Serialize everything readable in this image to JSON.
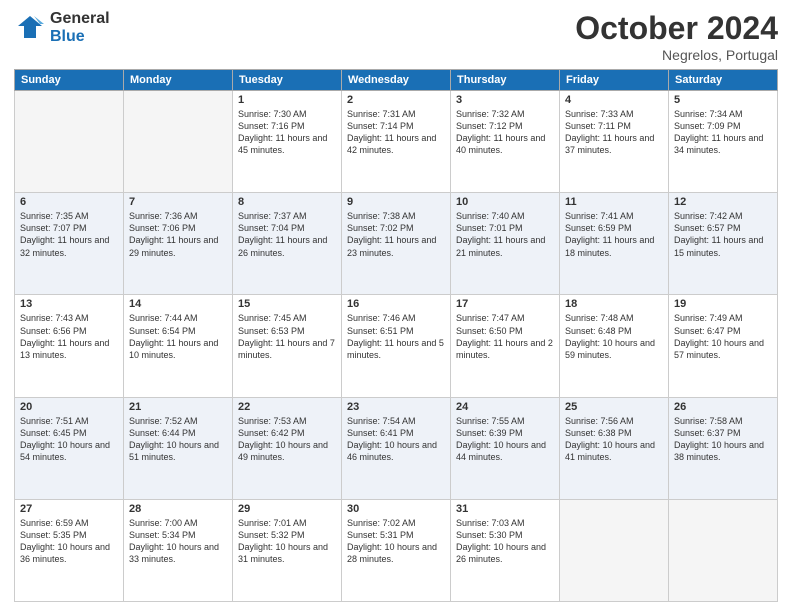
{
  "header": {
    "logo_general": "General",
    "logo_blue": "Blue",
    "month_title": "October 2024",
    "location": "Negrelos, Portugal"
  },
  "days_of_week": [
    "Sunday",
    "Monday",
    "Tuesday",
    "Wednesday",
    "Thursday",
    "Friday",
    "Saturday"
  ],
  "weeks": [
    [
      {
        "day": "",
        "info": ""
      },
      {
        "day": "",
        "info": ""
      },
      {
        "day": "1",
        "info": "Sunrise: 7:30 AM\nSunset: 7:16 PM\nDaylight: 11 hours and 45 minutes."
      },
      {
        "day": "2",
        "info": "Sunrise: 7:31 AM\nSunset: 7:14 PM\nDaylight: 11 hours and 42 minutes."
      },
      {
        "day": "3",
        "info": "Sunrise: 7:32 AM\nSunset: 7:12 PM\nDaylight: 11 hours and 40 minutes."
      },
      {
        "day": "4",
        "info": "Sunrise: 7:33 AM\nSunset: 7:11 PM\nDaylight: 11 hours and 37 minutes."
      },
      {
        "day": "5",
        "info": "Sunrise: 7:34 AM\nSunset: 7:09 PM\nDaylight: 11 hours and 34 minutes."
      }
    ],
    [
      {
        "day": "6",
        "info": "Sunrise: 7:35 AM\nSunset: 7:07 PM\nDaylight: 11 hours and 32 minutes."
      },
      {
        "day": "7",
        "info": "Sunrise: 7:36 AM\nSunset: 7:06 PM\nDaylight: 11 hours and 29 minutes."
      },
      {
        "day": "8",
        "info": "Sunrise: 7:37 AM\nSunset: 7:04 PM\nDaylight: 11 hours and 26 minutes."
      },
      {
        "day": "9",
        "info": "Sunrise: 7:38 AM\nSunset: 7:02 PM\nDaylight: 11 hours and 23 minutes."
      },
      {
        "day": "10",
        "info": "Sunrise: 7:40 AM\nSunset: 7:01 PM\nDaylight: 11 hours and 21 minutes."
      },
      {
        "day": "11",
        "info": "Sunrise: 7:41 AM\nSunset: 6:59 PM\nDaylight: 11 hours and 18 minutes."
      },
      {
        "day": "12",
        "info": "Sunrise: 7:42 AM\nSunset: 6:57 PM\nDaylight: 11 hours and 15 minutes."
      }
    ],
    [
      {
        "day": "13",
        "info": "Sunrise: 7:43 AM\nSunset: 6:56 PM\nDaylight: 11 hours and 13 minutes."
      },
      {
        "day": "14",
        "info": "Sunrise: 7:44 AM\nSunset: 6:54 PM\nDaylight: 11 hours and 10 minutes."
      },
      {
        "day": "15",
        "info": "Sunrise: 7:45 AM\nSunset: 6:53 PM\nDaylight: 11 hours and 7 minutes."
      },
      {
        "day": "16",
        "info": "Sunrise: 7:46 AM\nSunset: 6:51 PM\nDaylight: 11 hours and 5 minutes."
      },
      {
        "day": "17",
        "info": "Sunrise: 7:47 AM\nSunset: 6:50 PM\nDaylight: 11 hours and 2 minutes."
      },
      {
        "day": "18",
        "info": "Sunrise: 7:48 AM\nSunset: 6:48 PM\nDaylight: 10 hours and 59 minutes."
      },
      {
        "day": "19",
        "info": "Sunrise: 7:49 AM\nSunset: 6:47 PM\nDaylight: 10 hours and 57 minutes."
      }
    ],
    [
      {
        "day": "20",
        "info": "Sunrise: 7:51 AM\nSunset: 6:45 PM\nDaylight: 10 hours and 54 minutes."
      },
      {
        "day": "21",
        "info": "Sunrise: 7:52 AM\nSunset: 6:44 PM\nDaylight: 10 hours and 51 minutes."
      },
      {
        "day": "22",
        "info": "Sunrise: 7:53 AM\nSunset: 6:42 PM\nDaylight: 10 hours and 49 minutes."
      },
      {
        "day": "23",
        "info": "Sunrise: 7:54 AM\nSunset: 6:41 PM\nDaylight: 10 hours and 46 minutes."
      },
      {
        "day": "24",
        "info": "Sunrise: 7:55 AM\nSunset: 6:39 PM\nDaylight: 10 hours and 44 minutes."
      },
      {
        "day": "25",
        "info": "Sunrise: 7:56 AM\nSunset: 6:38 PM\nDaylight: 10 hours and 41 minutes."
      },
      {
        "day": "26",
        "info": "Sunrise: 7:58 AM\nSunset: 6:37 PM\nDaylight: 10 hours and 38 minutes."
      }
    ],
    [
      {
        "day": "27",
        "info": "Sunrise: 6:59 AM\nSunset: 5:35 PM\nDaylight: 10 hours and 36 minutes."
      },
      {
        "day": "28",
        "info": "Sunrise: 7:00 AM\nSunset: 5:34 PM\nDaylight: 10 hours and 33 minutes."
      },
      {
        "day": "29",
        "info": "Sunrise: 7:01 AM\nSunset: 5:32 PM\nDaylight: 10 hours and 31 minutes."
      },
      {
        "day": "30",
        "info": "Sunrise: 7:02 AM\nSunset: 5:31 PM\nDaylight: 10 hours and 28 minutes."
      },
      {
        "day": "31",
        "info": "Sunrise: 7:03 AM\nSunset: 5:30 PM\nDaylight: 10 hours and 26 minutes."
      },
      {
        "day": "",
        "info": ""
      },
      {
        "day": "",
        "info": ""
      }
    ]
  ]
}
